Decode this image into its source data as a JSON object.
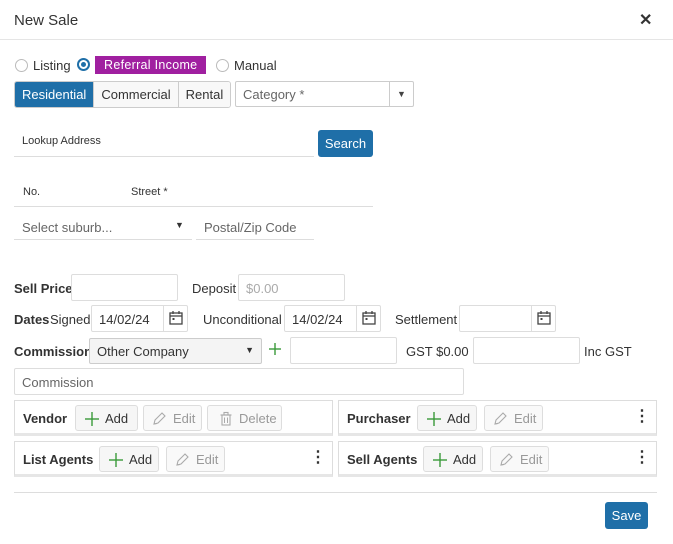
{
  "dialog": {
    "title": "New Sale"
  },
  "sale_type": {
    "options": [
      "Listing",
      "Referral Income",
      "Manual"
    ],
    "selected": "Referral Income"
  },
  "property_type": {
    "options": [
      "Residential",
      "Commercial",
      "Rental"
    ],
    "selected": "Residential"
  },
  "category": {
    "placeholder": "Category *"
  },
  "lookup": {
    "label": "Lookup Address",
    "search_label": "Search"
  },
  "address": {
    "no_label": "No.",
    "street_label": "Street *",
    "suburb_placeholder": "Select suburb...",
    "postal_placeholder": "Postal/Zip Code"
  },
  "price": {
    "sell_price_label": "Sell Price",
    "deposit_label": "Deposit",
    "deposit_placeholder": "$0.00"
  },
  "dates": {
    "label": "Dates",
    "signed_label": "Signed",
    "signed_value": "14/02/24",
    "unconditional_label": "Unconditional",
    "unconditional_value": "14/02/24",
    "settlement_label": "Settlement"
  },
  "commission": {
    "label": "Commission",
    "company_value": "Other Company",
    "gst_label": "GST $0.00",
    "inc_gst_label": "Inc GST",
    "description_placeholder": "Commission"
  },
  "panels": {
    "vendor": {
      "title": "Vendor",
      "add": "Add",
      "edit": "Edit",
      "delete": "Delete"
    },
    "purchaser": {
      "title": "Purchaser",
      "add": "Add",
      "edit": "Edit"
    },
    "list_agents": {
      "title": "List Agents",
      "add": "Add",
      "edit": "Edit"
    },
    "sell_agents": {
      "title": "Sell Agents",
      "add": "Add",
      "edit": "Edit"
    }
  },
  "footer": {
    "save_label": "Save"
  },
  "colors": {
    "primary": "#1f6fa8",
    "referral_badge": "#a020a0",
    "add_icon": "#3a9a3a"
  }
}
